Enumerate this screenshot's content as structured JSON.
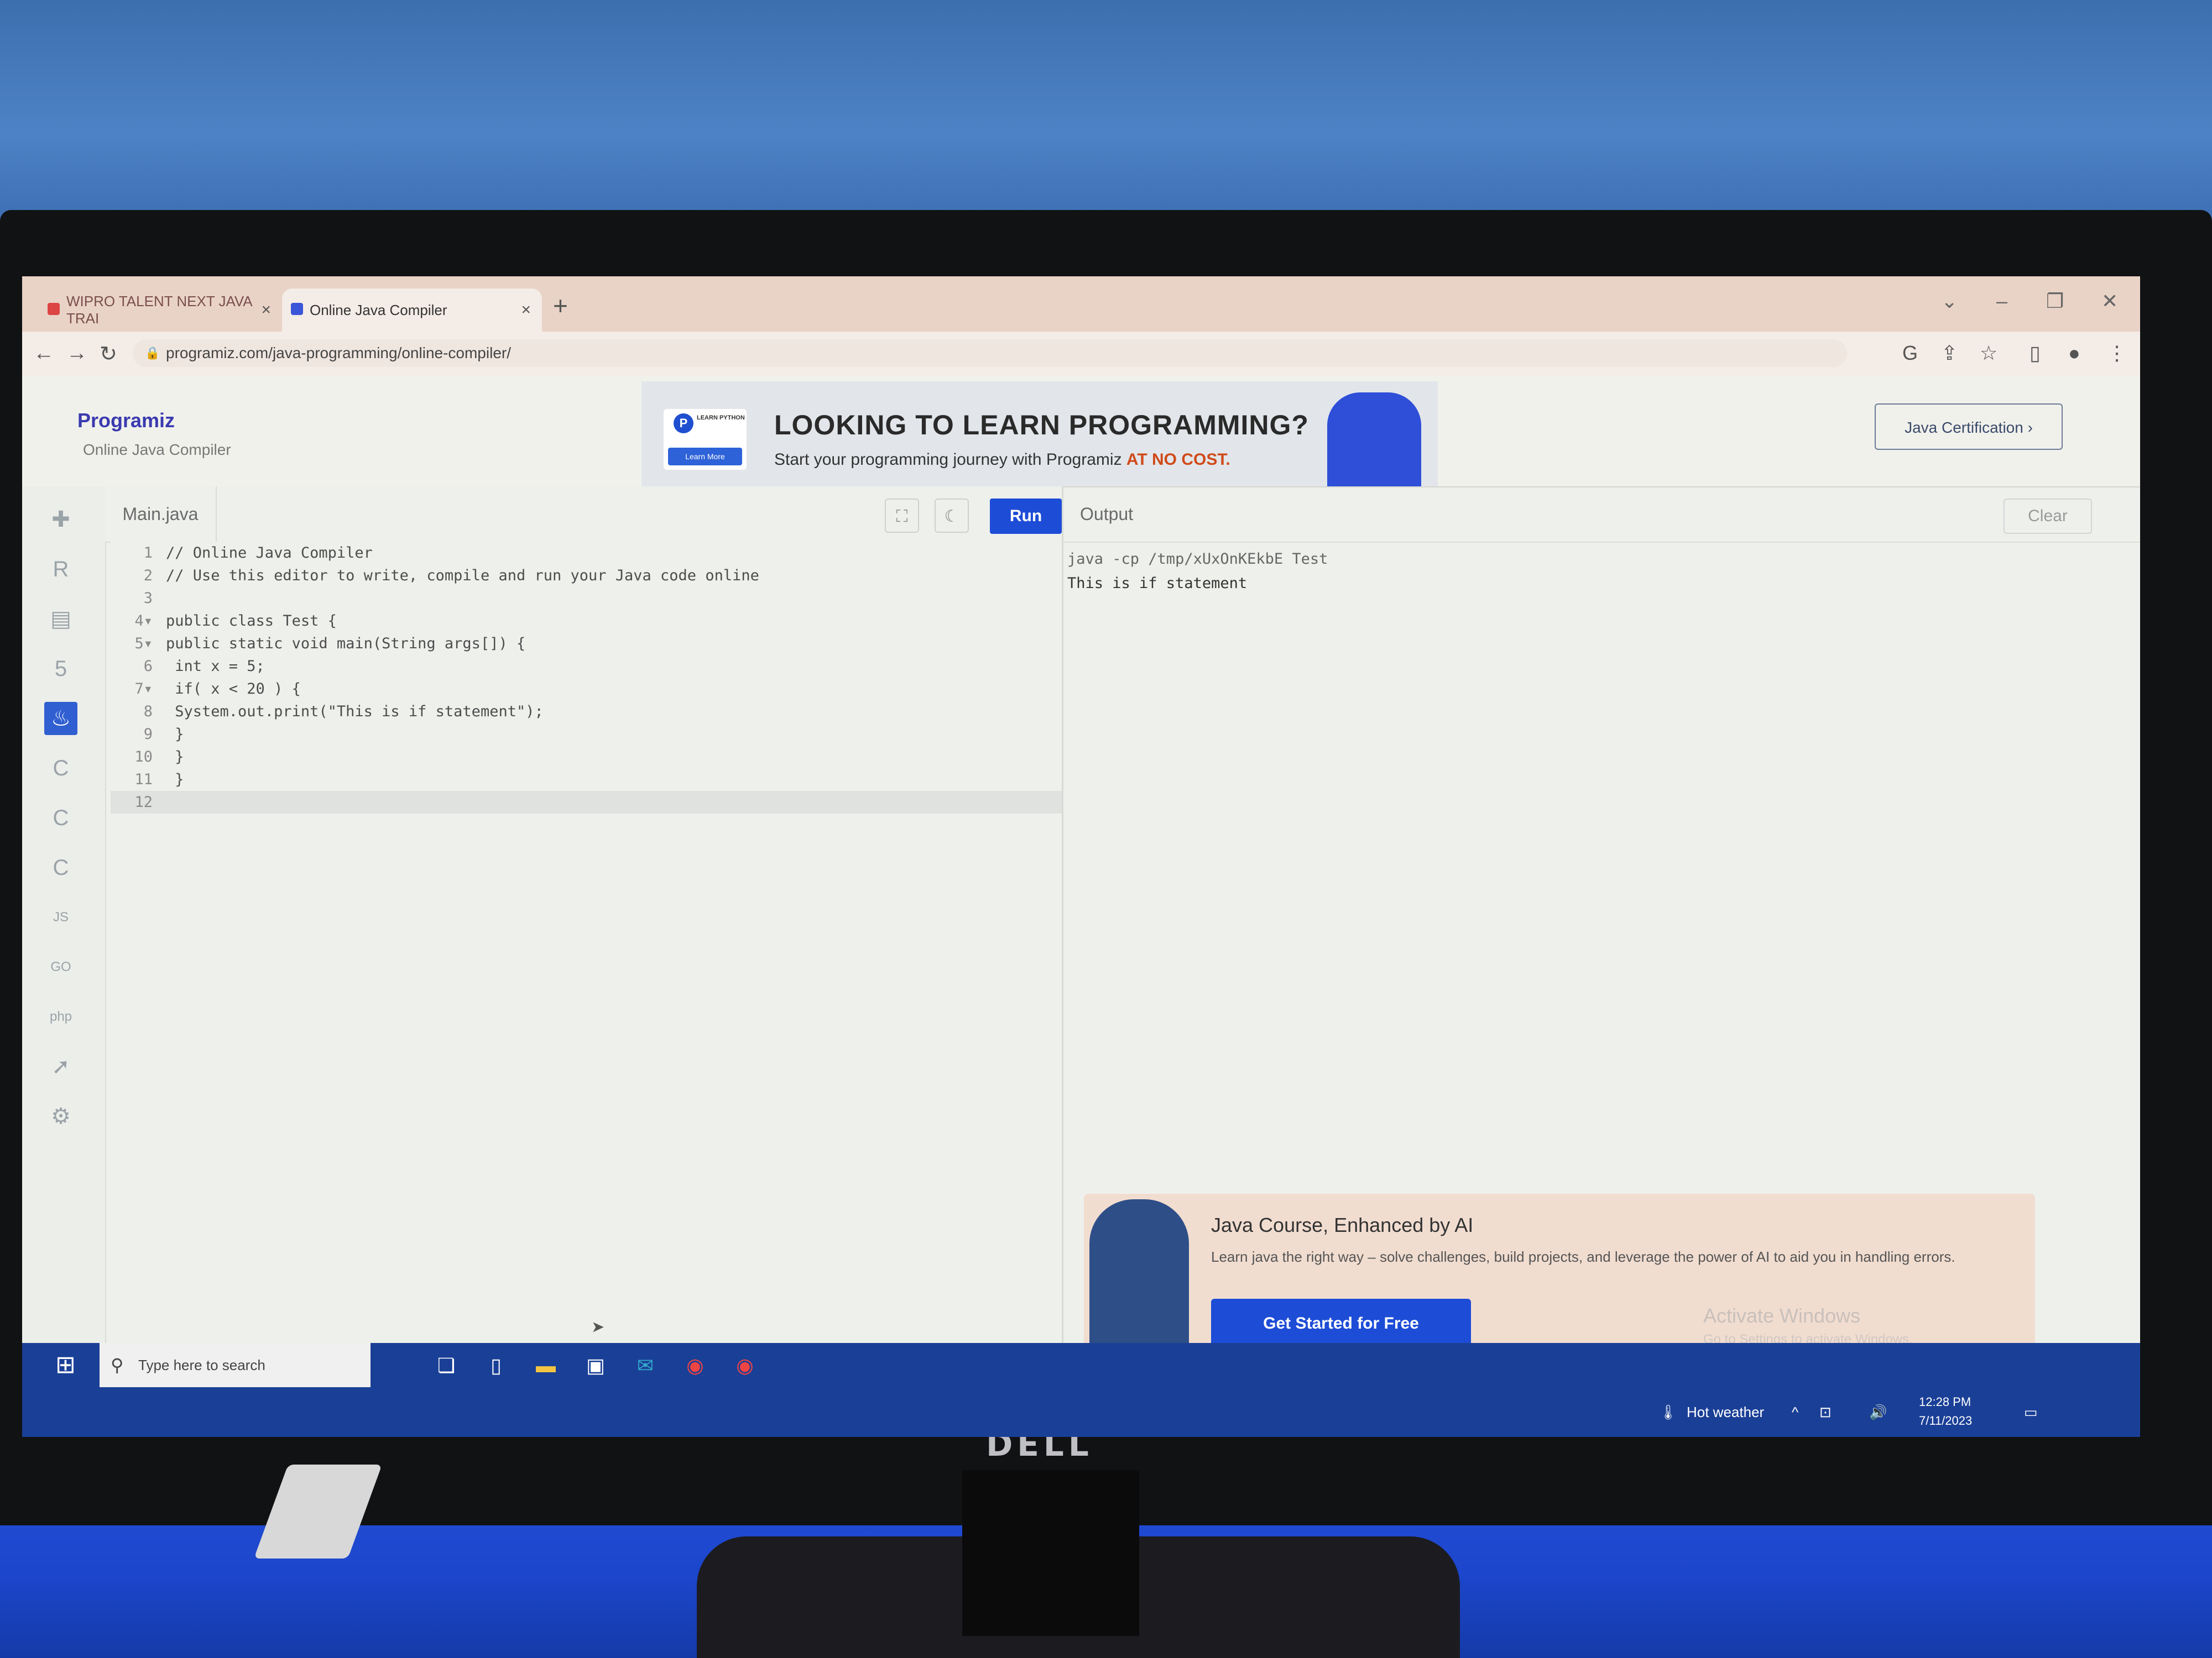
{
  "browser": {
    "tabs": [
      {
        "label": "WIPRO TALENT NEXT JAVA TRAI",
        "active": false
      },
      {
        "label": "Online Java Compiler",
        "active": true
      }
    ],
    "url": "programiz.com/java-programming/online-compiler/"
  },
  "site": {
    "brand": "Programiz",
    "subtitle": "Online Java Compiler",
    "banner": {
      "mini_text": "LEARN PYTHON",
      "mini_button": "Learn More",
      "headline": "LOOKING TO LEARN PROGRAMMING?",
      "subline": "Start your programming journey with Programiz",
      "highlight": "AT NO COST."
    },
    "cert_button": "Java Certification ›"
  },
  "editor": {
    "file_tab": "Main.java",
    "run_label": "Run",
    "lines": [
      {
        "n": "1",
        "text": "// Online Java Compiler"
      },
      {
        "n": "2",
        "text": "// Use this editor to write, compile and run your Java code online"
      },
      {
        "n": "3",
        "text": ""
      },
      {
        "n": "4▾",
        "text": "public class Test {"
      },
      {
        "n": "5▾",
        "text": "public static void main(String args[]) {"
      },
      {
        "n": "6",
        "text": " int x = 5;"
      },
      {
        "n": "7▾",
        "text": " if( x < 20 ) {"
      },
      {
        "n": "8",
        "text": " System.out.print(\"This is if statement\");"
      },
      {
        "n": "9",
        "text": " }"
      },
      {
        "n": "10",
        "text": " }"
      },
      {
        "n": "11",
        "text": " }"
      },
      {
        "n": "12",
        "text": ""
      }
    ]
  },
  "output": {
    "label": "Output",
    "clear_label": "Clear",
    "command": "java -cp /tmp/xUxOnKEkbE Test",
    "result": "This is if statement"
  },
  "promo": {
    "title": "Java Course, Enhanced by AI",
    "description": "Learn java the right way – solve challenges, build projects, and leverage the power of AI to aid you in handling errors.",
    "button": "Get Started for Free"
  },
  "watermark": {
    "title": "Activate Windows",
    "subtitle": "Go to Settings to activate Windows."
  },
  "taskbar": {
    "search_placeholder": "Type here to search",
    "weather": "Hot weather",
    "time": "12:28 PM",
    "date": "7/11/2023"
  },
  "monitor": {
    "brand": "DELL"
  }
}
